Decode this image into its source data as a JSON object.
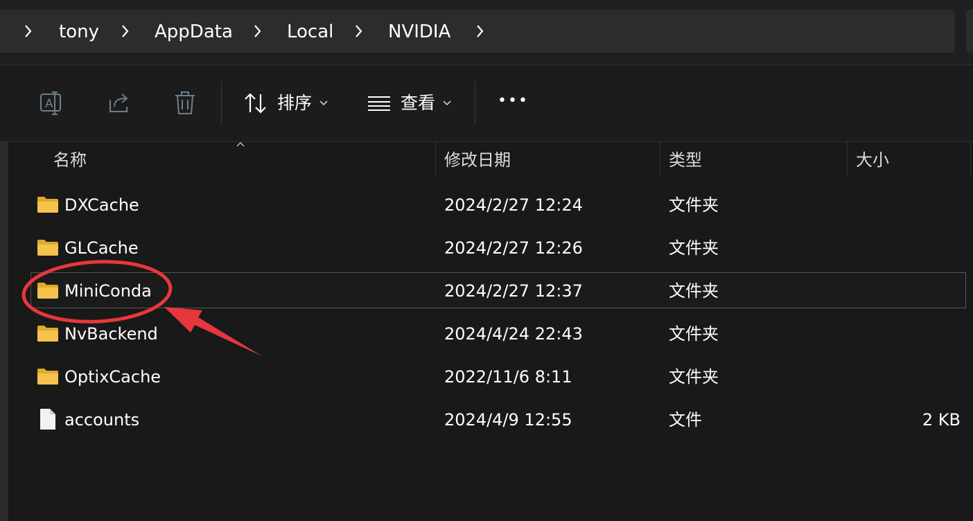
{
  "breadcrumb": {
    "items": [
      "tony",
      "AppData",
      "Local",
      "NVIDIA"
    ]
  },
  "toolbar": {
    "sort_label": "排序",
    "view_label": "查看",
    "more_label": "•••"
  },
  "columns": {
    "name": "名称",
    "modified": "修改日期",
    "type": "类型",
    "size": "大小"
  },
  "files": [
    {
      "name": "DXCache",
      "modified": "2024/2/27 12:24",
      "type": "文件夹",
      "size": "",
      "icon": "folder-icon"
    },
    {
      "name": "GLCache",
      "modified": "2024/2/27 12:26",
      "type": "文件夹",
      "size": "",
      "icon": "folder-icon"
    },
    {
      "name": "MiniConda",
      "modified": "2024/2/27 12:37",
      "type": "文件夹",
      "size": "",
      "icon": "folder-icon"
    },
    {
      "name": "NvBackend",
      "modified": "2024/4/24 22:43",
      "type": "文件夹",
      "size": "",
      "icon": "folder-icon"
    },
    {
      "name": "OptixCache",
      "modified": "2022/11/6 8:11",
      "type": "文件夹",
      "size": "",
      "icon": "folder-icon"
    },
    {
      "name": "accounts",
      "modified": "2024/4/9 12:55",
      "type": "文件",
      "size": "2 KB",
      "icon": "file-icon"
    }
  ],
  "annotation_color": "#e8373c",
  "colors": {
    "background": "#191919",
    "folder": "#f5c24b",
    "selection_border": "#555555"
  }
}
